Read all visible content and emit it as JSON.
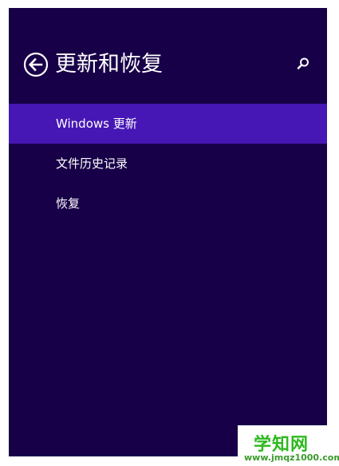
{
  "header": {
    "title": "更新和恢复",
    "back_icon": "back-arrow-circle-icon",
    "search_icon": "search-icon"
  },
  "nav": {
    "items": [
      {
        "label": "Windows 更新",
        "selected": true
      },
      {
        "label": "文件历史记录",
        "selected": false
      },
      {
        "label": "恢复",
        "selected": false
      }
    ]
  },
  "colors": {
    "panel_background": "#180048",
    "selected_item": "#4617b4",
    "text": "#ffffff",
    "watermark_green": "#2db81e"
  },
  "watermark": {
    "title": "学知网",
    "url": "www.jmqz1000.com"
  }
}
